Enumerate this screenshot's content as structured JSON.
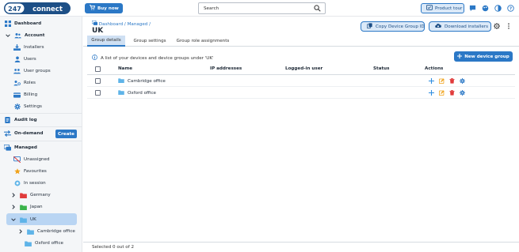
{
  "colors": {
    "brand": "#2b78c6",
    "selected_bg": "#b9d5f3",
    "folder": "#5fb4e8",
    "add_action": "#2f8ee0",
    "edit_action": "#f0a21a",
    "delete_action": "#e03b3b",
    "settings_action": "#2b78c6"
  },
  "topbar": {
    "logo_number": "247",
    "logo_word": "connect",
    "buy_label": "Buy now",
    "search_placeholder": "Search",
    "tour_label": "Product tour",
    "icons": [
      "chat-icon",
      "palette-icon",
      "contrast-icon",
      "help-icon",
      "user-icon"
    ]
  },
  "sidebar": {
    "dashboard": "Dashboard",
    "account": "Account",
    "installers": "Installers",
    "users": "Users",
    "user_groups": "User groups",
    "roles": "Roles",
    "billing": "Billing",
    "settings": "Settings",
    "audit_log": "Audit log",
    "on_demand": "On-demand",
    "create": "Create",
    "managed": "Managed",
    "unassigned": "Unassigned",
    "favourites": "Favourites",
    "in_session": "In session",
    "germany": "Germany",
    "japan": "Japan",
    "uk": "UK",
    "cambridge_office": "Cambridge office",
    "oxford_office": "Oxford office"
  },
  "header": {
    "breadcrumb": "Dashboard / Managed /",
    "title": "UK",
    "copy_id_label": "Copy Device Group ID",
    "download_label": "Download installers"
  },
  "tabs": [
    "Group details",
    "Group settings",
    "Group role assignments"
  ],
  "info_text": "A list of your devices and device groups under 'UK'",
  "new_group_label": "New device group",
  "table": {
    "columns": [
      "Name",
      "IP addresses",
      "Logged-in user",
      "Status",
      "Actions"
    ],
    "rows": [
      {
        "name": "Cambridge office",
        "ip": "",
        "user": "",
        "status": ""
      },
      {
        "name": "Oxford office",
        "ip": "",
        "user": "",
        "status": ""
      }
    ]
  },
  "footer_text": "Selected 0 out of 2"
}
